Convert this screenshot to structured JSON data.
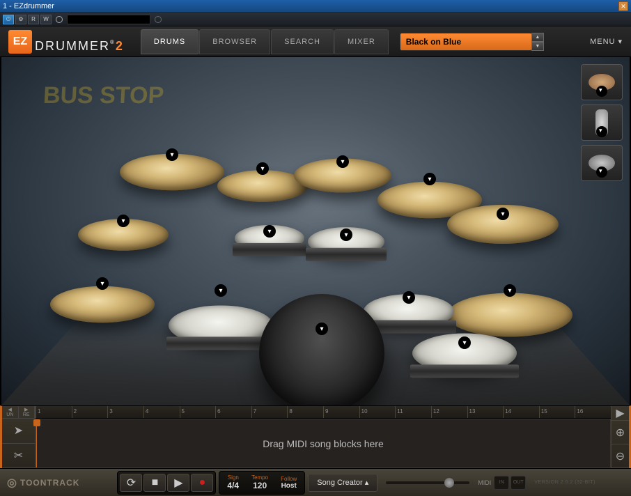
{
  "window": {
    "title": "1 - EZdrummer"
  },
  "host_toolbar": {
    "buttons": {
      "power": "⏻",
      "config": "⚙",
      "random": "R",
      "write": "W"
    }
  },
  "logo": {
    "ez": "EZ",
    "drummer": "DRUMMER",
    "reg": "®",
    "version": "2"
  },
  "tabs": [
    {
      "label": "DRUMS",
      "active": true
    },
    {
      "label": "BROWSER",
      "active": false
    },
    {
      "label": "SEARCH",
      "active": false
    },
    {
      "label": "MIXER",
      "active": false
    }
  ],
  "preset": {
    "name": "Black on Blue"
  },
  "menu": {
    "label": "MENU"
  },
  "drumview": {
    "bus_sign": "BUS\nSTOP"
  },
  "timeline": {
    "undo": "UN",
    "redo": "RE",
    "bars": [
      "1",
      "2",
      "3",
      "4",
      "5",
      "6",
      "7",
      "8",
      "9",
      "10",
      "11",
      "12",
      "13",
      "14",
      "15",
      "16"
    ],
    "drop_text": "Drag MIDI song blocks here"
  },
  "transport": {
    "brand": "TOONTRACK",
    "loop": "⟳",
    "stop": "■",
    "play": "▶",
    "record": "●",
    "sign_label": "Sign",
    "sign": "4/4",
    "tempo_label": "Tempo",
    "tempo": "120",
    "follow_label": "Follow",
    "follow": "Host",
    "song_creator": "Song Creator ▴",
    "midi_label": "MIDI",
    "midi_in": "IN",
    "midi_out": "OUT",
    "version": "VERSION 2.0.2 (32-BIT)"
  }
}
